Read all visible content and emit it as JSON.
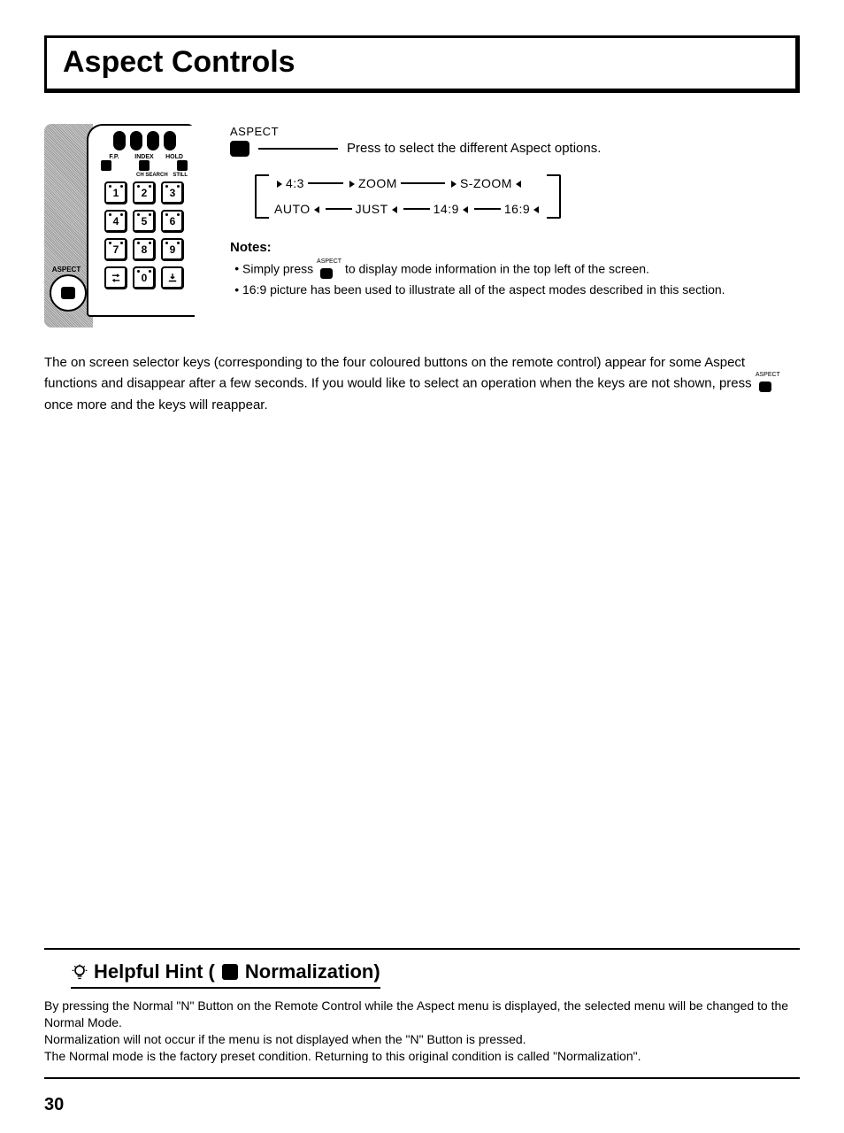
{
  "title": "Aspect Controls",
  "remote": {
    "top_labels": [
      "F.P.",
      "INDEX",
      "HOLD"
    ],
    "mid_labels": [
      "CH SEARCH",
      "STILL"
    ],
    "aspect_label": "ASPECT",
    "keys": [
      "1",
      "2",
      "3",
      "4",
      "5",
      "6",
      "7",
      "8",
      "9"
    ]
  },
  "aspect": {
    "label": "ASPECT",
    "press_text": "Press to select the different Aspect options.",
    "flow_top": [
      "4:3",
      "ZOOM",
      "S-ZOOM"
    ],
    "flow_bottom": [
      "AUTO",
      "JUST",
      "14:9",
      "16:9"
    ]
  },
  "notes": {
    "heading": "Notes:",
    "mini_label": "ASPECT",
    "line1a": "Simply press",
    "line1b": "to display mode information in the top left of the screen.",
    "line2": "16:9 picture has been used to illustrate all of the aspect modes described in this section."
  },
  "body": {
    "para_a": "The on screen selector keys (corresponding to the four coloured buttons on the remote control) appear for some Aspect functions and disappear after a few seconds. If you would like to select an operation when the keys are not shown, press",
    "mini_label": "ASPECT",
    "para_b": "once more and the keys will reappear."
  },
  "hint": {
    "title_a": "Helpful Hint (",
    "title_b": "Normalization)",
    "p1": "By pressing the Normal \"N\" Button on the Remote Control while the Aspect menu is displayed, the selected menu will be changed to the Normal Mode.",
    "p2": "Normalization will not occur if the menu is not displayed when the \"N\" Button is pressed.",
    "p3": "The Normal mode is the factory preset condition. Returning to this original condition is called \"Normalization\"."
  },
  "page_number": "30"
}
